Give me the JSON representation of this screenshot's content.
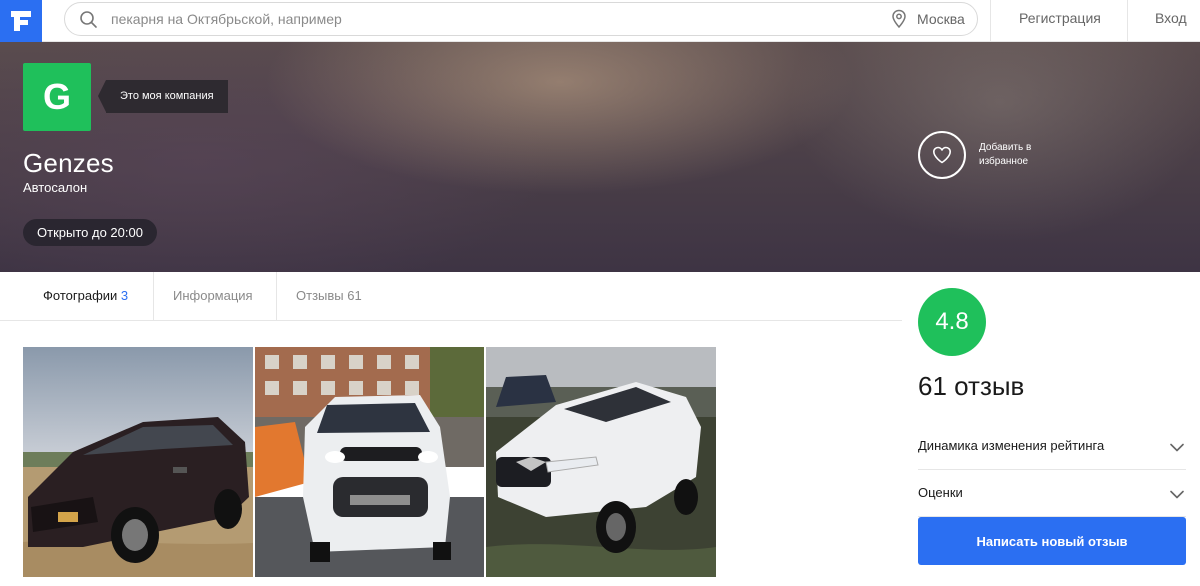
{
  "header": {
    "search_placeholder": "пекарня на Октябрьской, например",
    "city": "Москва",
    "register": "Регистрация",
    "login": "Вход"
  },
  "company": {
    "logo_letter": "G",
    "my_company": "Это моя компания",
    "name": "Genzes",
    "category": "Автосалон",
    "hours": "Открыто до 20:00",
    "favorite": "Добавить в избранное"
  },
  "tabs": [
    {
      "label": "Фотографии",
      "count": "3"
    },
    {
      "label": "Информация",
      "count": ""
    },
    {
      "label": "Отзывы",
      "count": "61"
    }
  ],
  "sidebar": {
    "rating": "4.8",
    "reviews_count": "61 отзыв",
    "rating_dynamics": "Динамика изменения рейтинга",
    "ratings": "Оценки",
    "write_review": "Написать новый отзыв"
  },
  "colors": {
    "brand_blue": "#2b6ff2",
    "rating_green": "#1fc05b"
  }
}
